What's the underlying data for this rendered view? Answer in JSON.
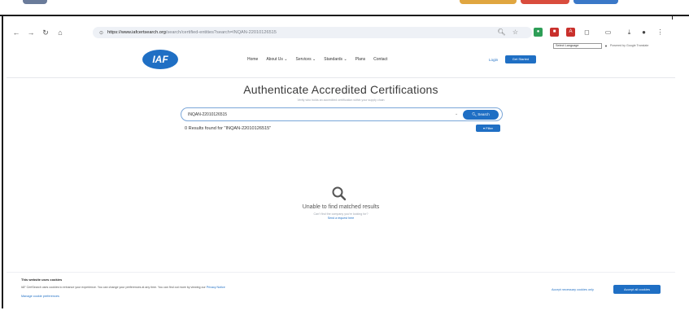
{
  "browser": {
    "url_host": "https://www.iafcertsearch.org",
    "url_path": "/search/certified-entities?search=INQAN-22010126515",
    "nav_back": "←",
    "nav_forward": "→",
    "nav_reload": "↻",
    "nav_home": "⌂"
  },
  "site": {
    "select_language": "Select Language",
    "powered_by": "Powered by Google Translate",
    "logo_text": "IAF",
    "nav": [
      "Home",
      "About Us ⌄",
      "Services ⌄",
      "Standards ⌄",
      "Plans",
      "Contact"
    ],
    "login": "Login",
    "get_started": "Get Started"
  },
  "main": {
    "title": "Authenticate Accredited Certifications",
    "subtitle": "Verify who holds an accredited certification within your supply chain",
    "search_value": "INQAN-22010126515",
    "search_button": "Search",
    "results_text": "0 Results found for \"INQAN-22010126515\"",
    "filter_button": "Filter",
    "empty_title": "Unable to find matched results",
    "empty_sub": "Can't find the company you're looking for?",
    "empty_link": "Send a request here"
  },
  "cookie": {
    "title": "This website uses cookies",
    "text": "IAF CertSearch uses cookies to enhance your experience. You can change your preferences at any time. You can find out more by viewing our",
    "privacy_link": "Privacy Notice",
    "manage": "Manage cookie preferences",
    "necessary": "Accept necessary cookies only",
    "accept_all": "Accept all cookies"
  }
}
